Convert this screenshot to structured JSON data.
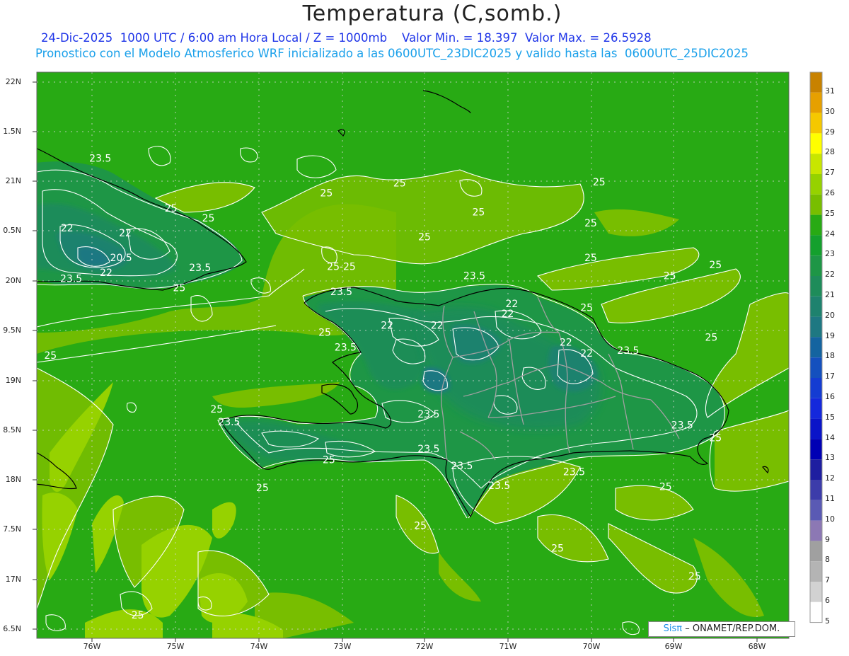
{
  "header": {
    "title": "Temperatura (C,somb.)",
    "line1": "24-Dic-2025  1000 UTC / 6:00 am Hora Local / Z = 1000mb    Valor Min. = 18.397  Valor Max. = 26.5928",
    "line2": "Pronostico con el Modelo Atmosferico WRF inicializado a las 0600UTC_23DIC2025 y valido hasta las  0600UTC_25DIC2025"
  },
  "axes": {
    "lat_labels": [
      "22N",
      "1.5N",
      "21N",
      "0.5N",
      "20N",
      "9.5N",
      "19N",
      "8.5N",
      "18N",
      "7.5N",
      "17N",
      "6.5N"
    ],
    "lon_labels": [
      "76W",
      "75W",
      "74W",
      "73W",
      "72W",
      "71W",
      "70W",
      "69W",
      "68W"
    ]
  },
  "colorbar": {
    "levels": [
      "31",
      "30",
      "29",
      "28",
      "27",
      "26",
      "25",
      "24",
      "23",
      "22",
      "21",
      "20",
      "19",
      "18",
      "17",
      "16",
      "15",
      "14",
      "13",
      "12",
      "11",
      "10",
      "9",
      "8",
      "7",
      "6",
      "5"
    ],
    "colors": [
      "#c88200",
      "#e6a000",
      "#f5c800",
      "#ffff00",
      "#c8e600",
      "#96d200",
      "#78be00",
      "#28aa14",
      "#14a02d",
      "#1e9646",
      "#1e8c5a",
      "#1e826e",
      "#1e7882",
      "#1464a0",
      "#1450be",
      "#143cd2",
      "#1428dc",
      "#0a14c8",
      "#0000b4",
      "#1e1ea0",
      "#3c3caa",
      "#5a5ab4",
      "#8c78b4",
      "#a0a0a0",
      "#b4b4b4",
      "#d2d2d2",
      "#ffffff"
    ]
  },
  "field_colors": {
    "land_interior": "#1e9646",
    "warm_sea": "#28aa14",
    "warmer_sea": "#78be00",
    "warmest": "#96d200"
  },
  "contour_labels": [
    {
      "text": "23.5",
      "lon": -75.9,
      "lat": 21.2
    },
    {
      "text": "25",
      "lon": -74.6,
      "lat": 20.6
    },
    {
      "text": "25",
      "lon": -75.05,
      "lat": 20.7
    },
    {
      "text": "22",
      "lon": -76.3,
      "lat": 20.5
    },
    {
      "text": "22",
      "lon": -75.6,
      "lat": 20.45
    },
    {
      "text": "20.5",
      "lon": -75.65,
      "lat": 20.2
    },
    {
      "text": "22",
      "lon": -75.83,
      "lat": 20.05
    },
    {
      "text": "23.5",
      "lon": -76.25,
      "lat": 19.99
    },
    {
      "text": "23.5",
      "lon": -74.7,
      "lat": 20.1
    },
    {
      "text": "25",
      "lon": -74.95,
      "lat": 19.9
    },
    {
      "text": "25",
      "lon": -73.18,
      "lat": 20.85
    },
    {
      "text": "25",
      "lon": -72.3,
      "lat": 20.95
    },
    {
      "text": "25",
      "lon": -71.35,
      "lat": 20.66
    },
    {
      "text": "25",
      "lon": -72.0,
      "lat": 20.41
    },
    {
      "text": "25",
      "lon": -69.9,
      "lat": 20.96
    },
    {
      "text": "25",
      "lon": -70.0,
      "lat": 20.55
    },
    {
      "text": "25",
      "lon": -70.0,
      "lat": 20.2
    },
    {
      "text": "25",
      "lon": -69.05,
      "lat": 20.02
    },
    {
      "text": "25",
      "lon": -68.5,
      "lat": 20.13
    },
    {
      "text": "25-25",
      "lon": -73.0,
      "lat": 20.11
    },
    {
      "text": "23.5",
      "lon": -71.4,
      "lat": 20.02
    },
    {
      "text": "23.5",
      "lon": -73.0,
      "lat": 19.86
    },
    {
      "text": "22",
      "lon": -70.95,
      "lat": 19.74
    },
    {
      "text": "22",
      "lon": -71.0,
      "lat": 19.64
    },
    {
      "text": "25",
      "lon": -70.05,
      "lat": 19.7
    },
    {
      "text": "22",
      "lon": -72.45,
      "lat": 19.52
    },
    {
      "text": "22",
      "lon": -71.85,
      "lat": 19.52
    },
    {
      "text": "25",
      "lon": -73.2,
      "lat": 19.45
    },
    {
      "text": "23.5",
      "lon": -72.95,
      "lat": 19.3
    },
    {
      "text": "22",
      "lon": -70.3,
      "lat": 19.35
    },
    {
      "text": "22",
      "lon": -70.05,
      "lat": 19.24
    },
    {
      "text": "23.5",
      "lon": -69.55,
      "lat": 19.27
    },
    {
      "text": "25",
      "lon": -68.55,
      "lat": 19.4
    },
    {
      "text": "25",
      "lon": -76.5,
      "lat": 19.22
    },
    {
      "text": "23.5",
      "lon": -71.95,
      "lat": 18.63
    },
    {
      "text": "25",
      "lon": -74.5,
      "lat": 18.68
    },
    {
      "text": "23.5",
      "lon": -74.35,
      "lat": 18.55
    },
    {
      "text": "23.5",
      "lon": -71.95,
      "lat": 18.28
    },
    {
      "text": "25",
      "lon": -73.15,
      "lat": 18.17
    },
    {
      "text": "23.5",
      "lon": -71.55,
      "lat": 18.11
    },
    {
      "text": "23.5",
      "lon": -71.1,
      "lat": 17.91
    },
    {
      "text": "23.5",
      "lon": -70.2,
      "lat": 18.05
    },
    {
      "text": "23.5",
      "lon": -68.9,
      "lat": 18.52
    },
    {
      "text": "25",
      "lon": -68.5,
      "lat": 18.39
    },
    {
      "text": "25",
      "lon": -73.95,
      "lat": 17.89
    },
    {
      "text": "25",
      "lon": -69.1,
      "lat": 17.9
    },
    {
      "text": "25",
      "lon": -72.05,
      "lat": 17.51
    },
    {
      "text": "25",
      "lon": -70.4,
      "lat": 17.28
    },
    {
      "text": "25",
      "lon": -68.75,
      "lat": 17.0
    },
    {
      "text": "25",
      "lon": -75.45,
      "lat": 16.61
    }
  ],
  "credit": {
    "prefix": "Sisπ",
    "suffix": "– ONAMET/REP.DOM."
  }
}
